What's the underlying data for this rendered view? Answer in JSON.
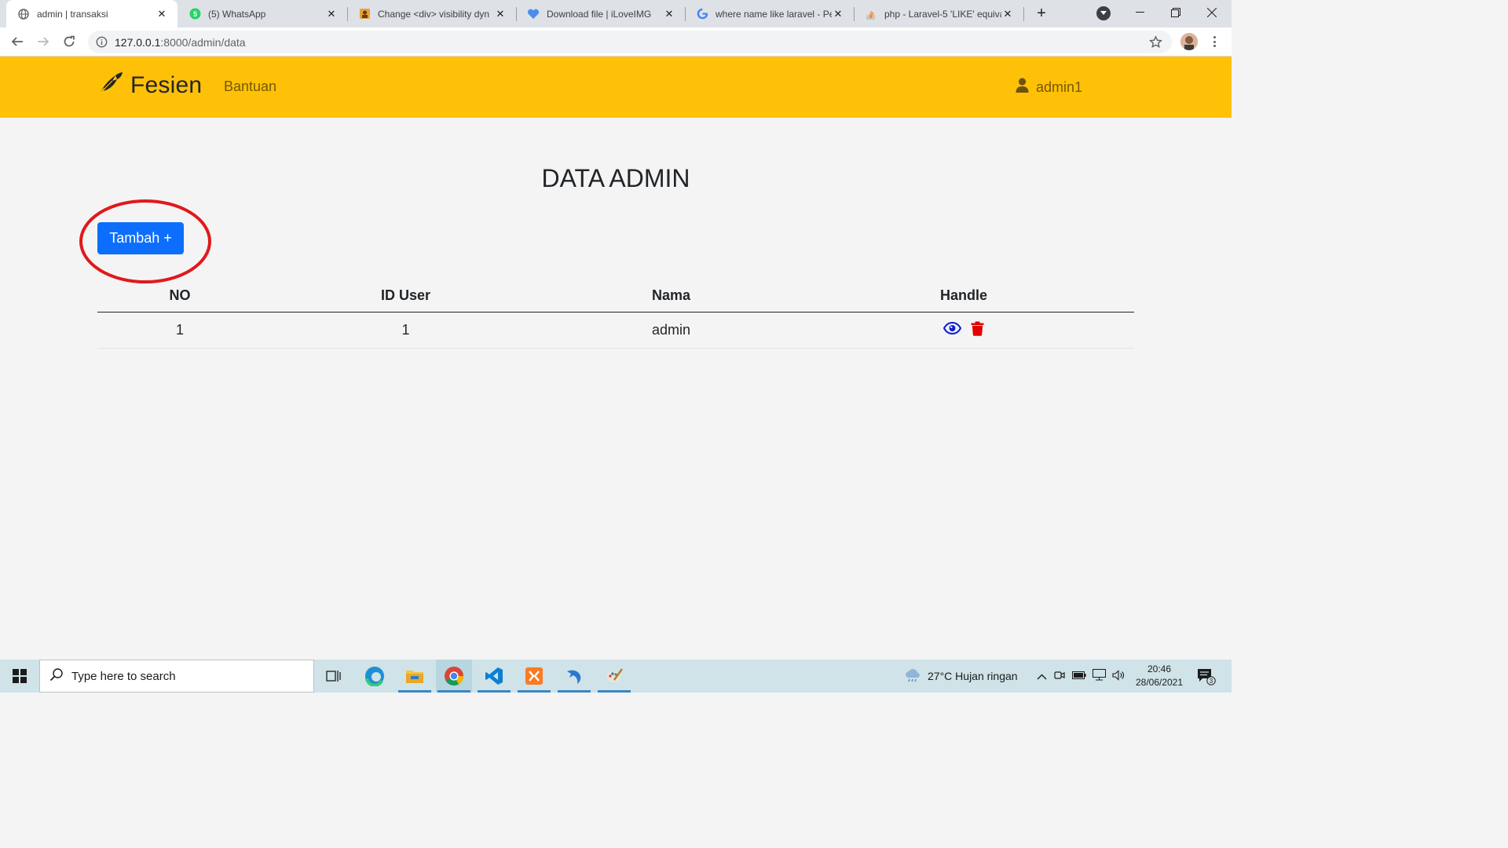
{
  "browser": {
    "tabs": [
      {
        "title": "admin | transaksi",
        "active": true,
        "icon": "globe-icon"
      },
      {
        "title": "(5) WhatsApp",
        "active": false,
        "icon": "whatsapp-icon"
      },
      {
        "title": "Change <div> visibility dyn",
        "active": false,
        "icon": "page-favicon"
      },
      {
        "title": "Download file | iLoveIMG",
        "active": false,
        "icon": "heart-favicon"
      },
      {
        "title": "where name like laravel - Pe",
        "active": false,
        "icon": "google-icon"
      },
      {
        "title": "php - Laravel-5 'LIKE' equiva",
        "active": false,
        "icon": "stackoverflow-icon"
      }
    ],
    "url_host": "127.0.0.1",
    "url_path": ":8000/admin/data"
  },
  "site": {
    "brand": "Fesien",
    "nav_link": "Bantuan",
    "user_label": "admin1",
    "navbar_color": "#ffc107"
  },
  "main": {
    "title": "DATA ADMIN",
    "add_button": "Tambah +",
    "add_button_color": "#0d6efd",
    "table": {
      "headers": [
        "NO",
        "ID User",
        "Nama",
        "Handle"
      ],
      "rows": [
        {
          "no": "1",
          "id_user": "1",
          "nama": "admin",
          "actions": [
            "eye-icon",
            "trash-icon"
          ]
        }
      ]
    }
  },
  "taskbar": {
    "search_placeholder": "Type here to search",
    "weather": "27°C  Hujan ringan",
    "time": "20:46",
    "date": "28/06/2021",
    "notification_count": "3"
  }
}
